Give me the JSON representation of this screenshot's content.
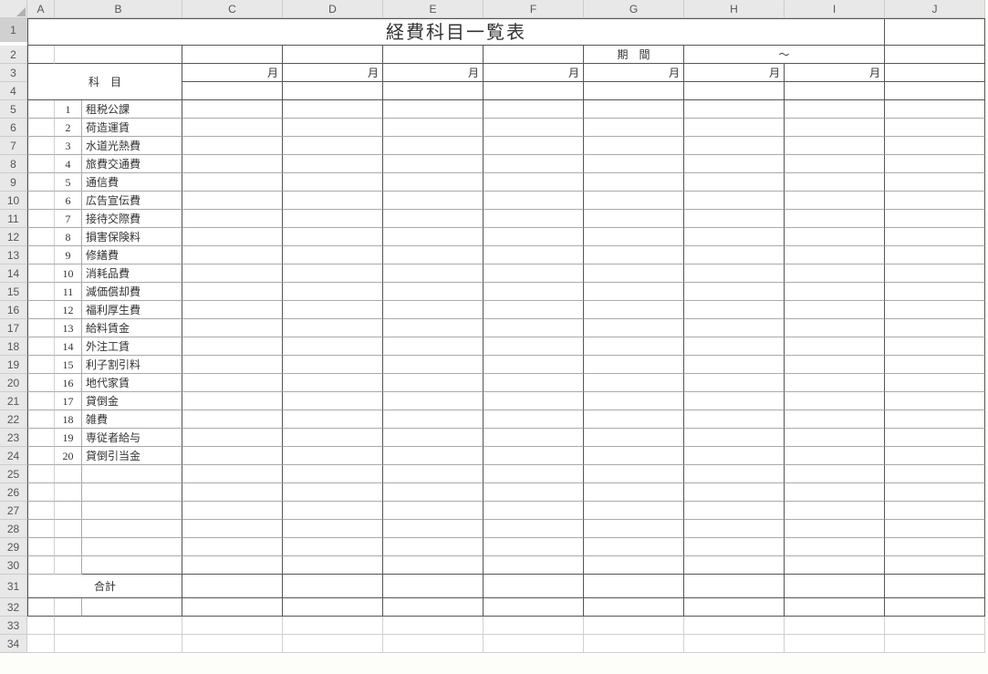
{
  "columns": [
    "A",
    "B",
    "C",
    "D",
    "E",
    "F",
    "G",
    "H",
    "I",
    "J"
  ],
  "row_count": 34,
  "title": "経費科目一覧表",
  "period_label": "期　間",
  "period_separator": "～",
  "subject_header": "科　目",
  "month_label": "月",
  "total_label": "合計",
  "items": [
    {
      "n": "1",
      "name": "租税公課"
    },
    {
      "n": "2",
      "name": "荷造運賃"
    },
    {
      "n": "3",
      "name": "水道光熱費"
    },
    {
      "n": "4",
      "name": "旅費交通費"
    },
    {
      "n": "5",
      "name": "通信費"
    },
    {
      "n": "6",
      "name": "広告宣伝費"
    },
    {
      "n": "7",
      "name": "接待交際費"
    },
    {
      "n": "8",
      "name": "損害保険料"
    },
    {
      "n": "9",
      "name": "修繕費"
    },
    {
      "n": "10",
      "name": "消耗品費"
    },
    {
      "n": "11",
      "name": "減価償却費"
    },
    {
      "n": "12",
      "name": "福利厚生費"
    },
    {
      "n": "13",
      "name": "給料賃金"
    },
    {
      "n": "14",
      "name": "外注工賃"
    },
    {
      "n": "15",
      "name": "利子割引料"
    },
    {
      "n": "16",
      "name": "地代家賃"
    },
    {
      "n": "17",
      "name": "貸倒金"
    },
    {
      "n": "18",
      "name": "雑費"
    },
    {
      "n": "19",
      "name": "専従者給与"
    },
    {
      "n": "20",
      "name": "貸倒引当金"
    }
  ],
  "selected_row": 1
}
